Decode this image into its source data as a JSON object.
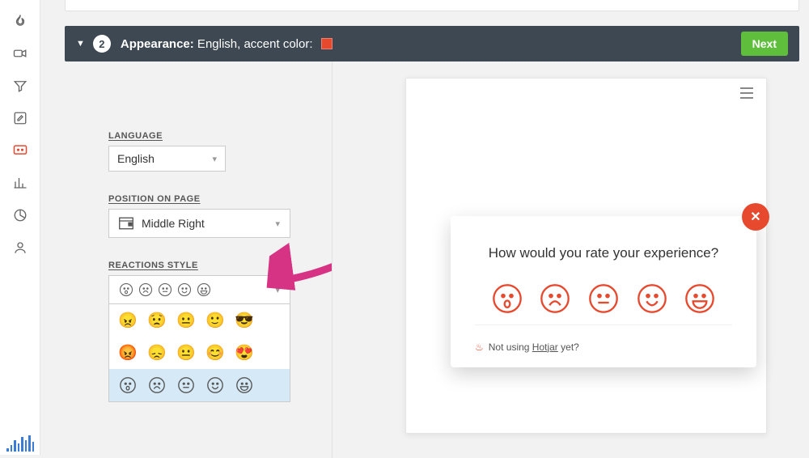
{
  "colors": {
    "accent": "#e7492e"
  },
  "sidebar": {
    "icons": [
      "flame",
      "videocam",
      "funnel",
      "edit-square",
      "survey",
      "bar-chart",
      "pie",
      "person"
    ]
  },
  "step": {
    "number": "2",
    "title_bold": "Appearance:",
    "title_rest": " English, accent color:",
    "next_label": "Next"
  },
  "config": {
    "language_label": "Language",
    "language_value": "English",
    "position_label": "Position on page",
    "position_value": "Middle Right",
    "reactions_label": "Reactions style",
    "reaction_rows": [
      {
        "style": "lego",
        "selected": false
      },
      {
        "style": "emoji",
        "selected": false
      },
      {
        "style": "outline",
        "selected": true
      }
    ]
  },
  "preview": {
    "question": "How would you rate your experience?",
    "footer_prefix": "Not using ",
    "footer_link": "Hotjar",
    "footer_suffix": " yet?"
  }
}
